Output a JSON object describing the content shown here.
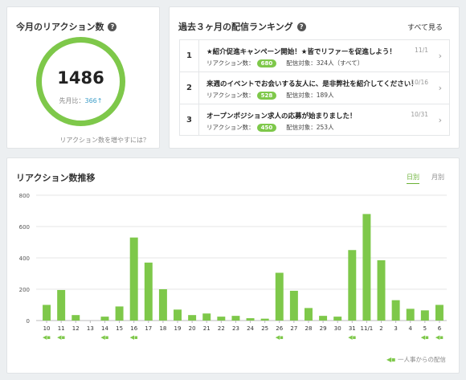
{
  "reaction": {
    "title": "今月のリアクション数",
    "value": "1486",
    "compare_label": "先月比：",
    "compare_value": "366",
    "compare_arrow": "↑",
    "tip_link": "リアクション数を増やすには？"
  },
  "ranking": {
    "title": "過去３ヶ月の配信ランキング",
    "see_all": "すべて見る",
    "reaction_label": "リアクション数：",
    "items": [
      {
        "rank": "1",
        "title": "★紹介促進キャンペーン開始！★皆でリファーを促進しよう！",
        "reactions": "680",
        "target": "配信対象：324人（すべて）",
        "date": "11/1"
      },
      {
        "rank": "2",
        "title": "来週のイベントでお会いする友人に、是非弊社を紹介してください！",
        "reactions": "528",
        "target": "配信対象：189人",
        "date": "10/16"
      },
      {
        "rank": "3",
        "title": "オープンポジション求人の応募が始まりました！",
        "reactions": "450",
        "target": "配信対象：253人",
        "date": "10/31"
      }
    ]
  },
  "trend": {
    "title": "リアクション数推移",
    "tabs": [
      "日別",
      "月別"
    ],
    "active_tab": "日別",
    "legend_note": "一人事からの配信",
    "flag_icon": "megaphone-icon"
  },
  "colors": {
    "accent": "#7ec84a",
    "link": "#3d9ec8"
  },
  "chart_data": {
    "type": "bar",
    "categories": [
      "10",
      "11",
      "12",
      "13",
      "14",
      "15",
      "16",
      "17",
      "18",
      "19",
      "20",
      "21",
      "22",
      "23",
      "24",
      "25",
      "26",
      "27",
      "28",
      "29",
      "30",
      "31",
      "11/1",
      "2",
      "3",
      "4",
      "5",
      "6"
    ],
    "values": [
      100,
      195,
      35,
      0,
      25,
      90,
      530,
      370,
      200,
      70,
      35,
      45,
      25,
      30,
      15,
      12,
      305,
      190,
      80,
      30,
      25,
      450,
      680,
      385,
      130,
      75,
      65,
      100
    ],
    "hr_post_flags": [
      true,
      true,
      false,
      false,
      true,
      false,
      true,
      false,
      false,
      false,
      false,
      false,
      false,
      false,
      false,
      false,
      true,
      false,
      false,
      false,
      false,
      true,
      false,
      false,
      false,
      false,
      true,
      true
    ],
    "ylim": [
      0,
      800
    ],
    "yticks": [
      0,
      200,
      400,
      600,
      800
    ],
    "grid": true
  }
}
